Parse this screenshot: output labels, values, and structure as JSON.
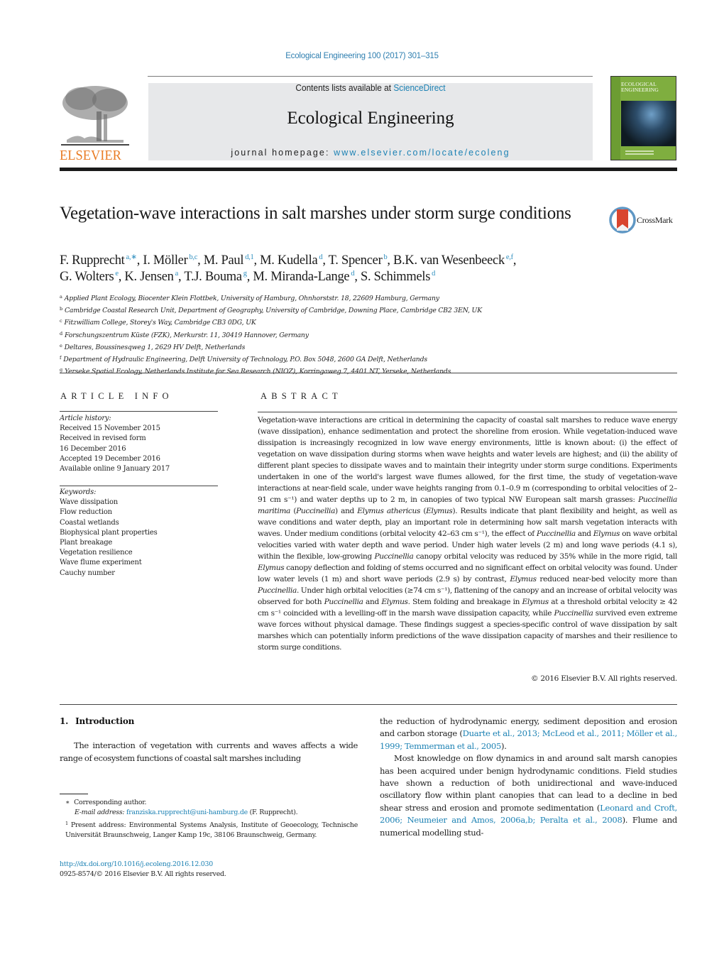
{
  "header": {
    "citation": "Ecological Engineering 100 (2017) 301–315",
    "contents_prefix": "Contents lists available at ",
    "contents_link": "ScienceDirect",
    "journal_title": "Ecological Engineering",
    "homepage_prefix": "journal homepage: ",
    "homepage_link": "www.elsevier.com/locate/ecoleng",
    "publisher_logo": "ELSEVIER",
    "cover_title_line1": "ECOLOGICAL",
    "cover_title_line2": "ENGINEERING",
    "crossmark_label": "CrossMark"
  },
  "colors": {
    "link": "#1d82b4",
    "elsevier_orange": "#e97c25",
    "masthead_bg": "#e7e8ea",
    "cover_green": "#7fae3f",
    "crossmark_red": "#d9452f"
  },
  "article": {
    "title": "Vegetation-wave interactions in salt marshes under storm surge conditions",
    "authors": [
      {
        "name": "F. Rupprecht",
        "aff": "a,∗"
      },
      {
        "name": "I. Möller",
        "aff": "b,c"
      },
      {
        "name": "M. Paul",
        "aff": "d,1"
      },
      {
        "name": "M. Kudella",
        "aff": "d"
      },
      {
        "name": "T. Spencer",
        "aff": "b"
      },
      {
        "name": "B.K. van Wesenbeeck",
        "aff": "e,f"
      },
      {
        "name": "G. Wolters",
        "aff": "e"
      },
      {
        "name": "K. Jensen",
        "aff": "a"
      },
      {
        "name": "T.J. Bouma",
        "aff": "g"
      },
      {
        "name": "M. Miranda-Lange",
        "aff": "d"
      },
      {
        "name": "S. Schimmels",
        "aff": "d"
      }
    ],
    "affiliations": [
      {
        "key": "a",
        "text": "Applied Plant Ecology, Biocenter Klein Flottbek, University of Hamburg, Ohnhorststr. 18, 22609 Hamburg, Germany"
      },
      {
        "key": "b",
        "text": "Cambridge Coastal Research Unit, Department of Geography, University of Cambridge, Downing Place, Cambridge CB2 3EN, UK"
      },
      {
        "key": "c",
        "text": "Fitzwilliam College, Storey's Way, Cambridge CB3 0DG, UK"
      },
      {
        "key": "d",
        "text": "Forschungszentrum Küste (FZK), Merkurstr. 11, 30419 Hannover, Germany"
      },
      {
        "key": "e",
        "text": "Deltares, Boussinesqweg 1, 2629 HV Delft, Netherlands"
      },
      {
        "key": "f",
        "text": "Department of Hydraulic Engineering, Delft University of Technology, P.O. Box 5048, 2600 GA Delft, Netherlands"
      },
      {
        "key": "g",
        "text": "Yerseke Spatial Ecology, Netherlands Institute for Sea Research (NIOZ), Korringaweg 7, 4401 NT, Yerseke, Netherlands"
      }
    ]
  },
  "article_info": {
    "heading": "ARTICLE INFO",
    "history_label": "Article history:",
    "history": [
      "Received 15 November 2015",
      "Received in revised form",
      "16 December 2016",
      "Accepted 19 December 2016",
      "Available online 9 January 2017"
    ],
    "keywords_label": "Keywords:",
    "keywords": [
      "Wave dissipation",
      "Flow reduction",
      "Coastal wetlands",
      "Biophysical plant properties",
      "Plant breakage",
      "Vegetation resilience",
      "Wave flume experiment",
      "Cauchy number"
    ]
  },
  "abstract": {
    "heading": "ABSTRACT",
    "segments": [
      {
        "t": "Vegetation-wave interactions are critical in determining the capacity of coastal salt marshes to reduce wave energy (wave dissipation), enhance sedimentation and protect the shoreline from erosion. While vegetation-induced wave dissipation is increasingly recognized in low wave energy environments, little is known about: (i) the effect of vegetation on wave dissipation during storms when wave heights and water levels are highest; and (ii) the ability of different plant species to dissipate waves and to maintain their integrity under storm surge conditions. Experiments undertaken in one of the world's largest wave flumes allowed, for the first time, the study of vegetation-wave interactions at near-field scale, under wave heights ranging from 0.1–0.9 m (corresponding to orbital velocities of 2–91 cm s⁻¹) and water depths up to 2 m, in canopies of two typical NW European salt marsh grasses: "
      },
      {
        "t": "Puccinellia maritima",
        "i": true
      },
      {
        "t": " ("
      },
      {
        "t": "Puccinellia",
        "i": true
      },
      {
        "t": ") and "
      },
      {
        "t": "Elymus athericus",
        "i": true
      },
      {
        "t": " ("
      },
      {
        "t": "Elymus",
        "i": true
      },
      {
        "t": "). Results indicate that plant flexibility and height, as well as wave conditions and water depth, play an important role in determining how salt marsh vegetation interacts with waves. Under medium conditions (orbital velocity 42–63 cm s⁻¹), the effect of "
      },
      {
        "t": "Puccinellia",
        "i": true
      },
      {
        "t": " and "
      },
      {
        "t": "Elymus",
        "i": true
      },
      {
        "t": " on wave orbital velocities varied with water depth and wave period. Under high water levels (2 m) and long wave periods (4.1 s), within the flexible, low-growing "
      },
      {
        "t": "Puccinellia",
        "i": true
      },
      {
        "t": " canopy orbital velocity was reduced by 35% while in the more rigid, tall "
      },
      {
        "t": "Elymus",
        "i": true
      },
      {
        "t": " canopy deflection and folding of stems occurred and no significant effect on orbital velocity was found. Under low water levels (1 m) and short wave periods (2.9 s) by contrast, "
      },
      {
        "t": "Elymus",
        "i": true
      },
      {
        "t": " reduced near-bed velocity more than "
      },
      {
        "t": "Puccinellia",
        "i": true
      },
      {
        "t": ". Under high orbital velocities (≥74 cm s⁻¹), flattening of the canopy and an increase of orbital velocity was observed for both "
      },
      {
        "t": "Puccinellia",
        "i": true
      },
      {
        "t": " and "
      },
      {
        "t": "Elymus",
        "i": true
      },
      {
        "t": ". Stem folding and breakage in "
      },
      {
        "t": "Elymus",
        "i": true
      },
      {
        "t": " at a threshold orbital velocity ≥ 42 cm s⁻¹ coincided with a levelling-off in the marsh wave dissipation capacity, while "
      },
      {
        "t": "Puccinellia",
        "i": true
      },
      {
        "t": " survived even extreme wave forces without physical damage. These findings suggest a species-specific control of wave dissipation by salt marshes which can potentially inform predictions of the wave dissipation capacity of marshes and their resilience to storm surge conditions."
      }
    ],
    "copyright": "© 2016 Elsevier B.V. All rights reserved."
  },
  "introduction": {
    "number": "1.",
    "heading": "Introduction",
    "left_para": "The interaction of vegetation with currents and waves affects a wide range of ecosystem functions of coastal salt marshes including",
    "right_para1_text": "the reduction of hydrodynamic energy, sediment deposition and erosion and carbon storage (",
    "right_para1_refs": "Duarte et al., 2013; McLeod et al., 2011; Möller et al., 1999; Temmerman et al., 2005",
    "right_para1_end": ").",
    "right_para2_text": "Most knowledge on flow dynamics in and around salt marsh canopies has been acquired under benign hydrodynamic conditions. Field studies have shown a reduction of both unidirectional and wave-induced oscillatory flow within plant canopies that can lead to a decline in bed shear stress and erosion and promote sedimentation (",
    "right_para2_refs": "Leonard and Croft, 2006; Neumeier and Amos, 2006a,b; Peralta et al., 2008",
    "right_para2_end": "). Flume and numerical modelling stud-"
  },
  "footnotes": {
    "corresponding_mark": "∗",
    "corresponding_text": "Corresponding author.",
    "email_label": "E-mail address: ",
    "email": "franziska.rupprecht@uni-hamburg.de",
    "email_suffix": " (F. Rupprecht).",
    "present_mark": "1",
    "present_text": "Present address: Environmental Systems Analysis, Institute of Geoecology, Technische Universität Braunschweig, Langer Kamp 19c, 38106 Braunschweig, Germany.",
    "doi": "http://dx.doi.org/10.1016/j.ecoleng.2016.12.030",
    "issn_line": "0925-8574/© 2016 Elsevier B.V. All rights reserved."
  }
}
